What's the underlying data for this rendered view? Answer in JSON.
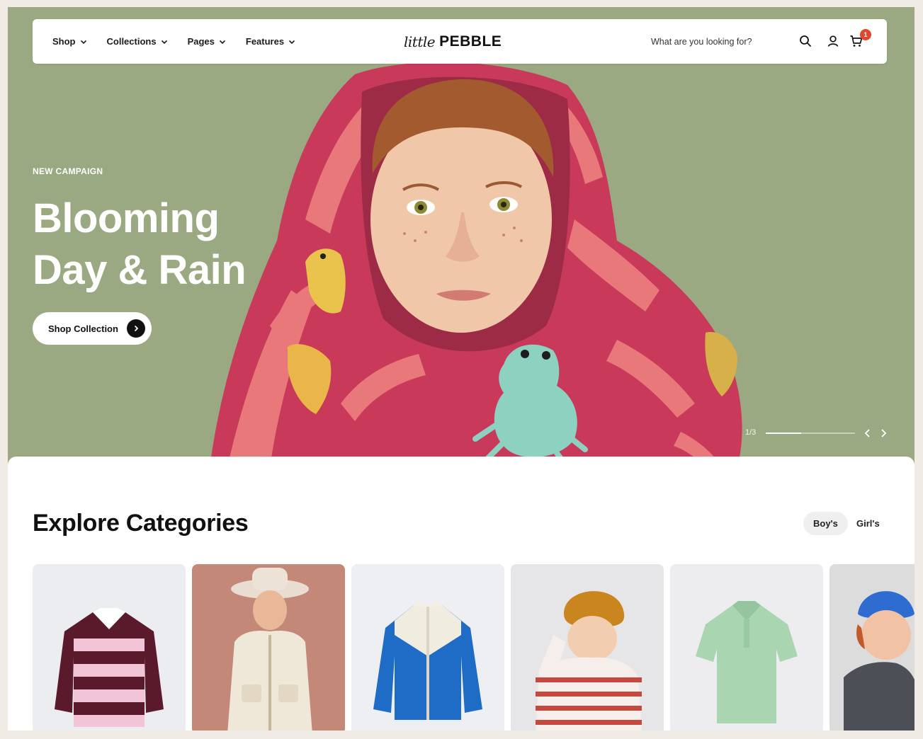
{
  "header": {
    "nav": [
      {
        "label": "Shop"
      },
      {
        "label": "Collections"
      },
      {
        "label": "Pages"
      },
      {
        "label": "Features"
      }
    ],
    "logo_script": "little",
    "logo_main": "PEBBLE",
    "search_placeholder": "What are you looking for?",
    "icons": [
      "search-icon",
      "user-icon",
      "cart-icon"
    ],
    "cart_count": "1"
  },
  "hero": {
    "eyebrow": "NEW CAMPAIGN",
    "headline_line1": "Blooming",
    "headline_line2": "Day & Rain",
    "cta_label": "Shop Collection",
    "slide_indicator": "1/3",
    "progress": 0.4,
    "background_color": "#9aa981"
  },
  "categories": {
    "title": "Explore Categories",
    "tabs": [
      {
        "label": "Boy's",
        "active": true
      },
      {
        "label": "Girl's",
        "active": false
      }
    ],
    "cards": [
      {
        "name": "striped-rugby-sweater"
      },
      {
        "name": "boy-in-hat-fleece-vest"
      },
      {
        "name": "blue-track-jacket"
      },
      {
        "name": "boy-in-beanie-striped-shirt"
      },
      {
        "name": "mint-polo-shirt"
      },
      {
        "name": "boy-in-blue-beanie"
      }
    ]
  },
  "colors": {
    "accent": "#111111",
    "badge": "#e0472f",
    "hero_green": "#9aa981",
    "page_bg": "#f1ebe6"
  }
}
